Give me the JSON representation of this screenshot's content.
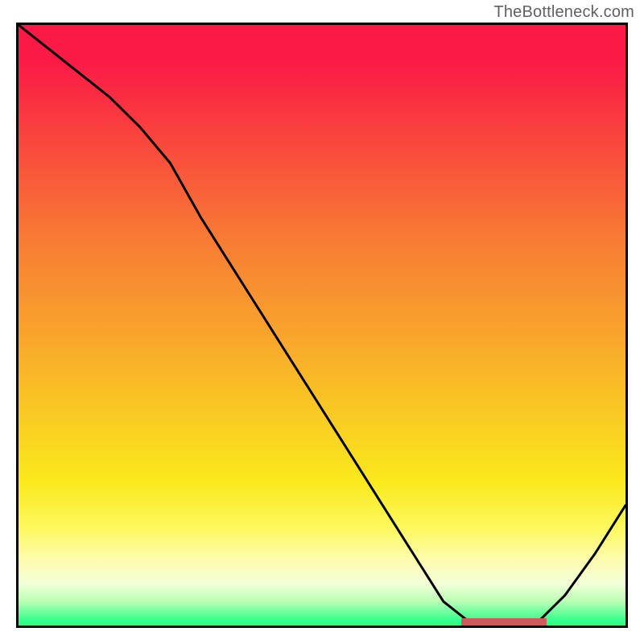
{
  "watermark": "TheBottleneck.com",
  "colors": {
    "gradient_top": "#fb1a46",
    "gradient_mid1": "#f87c34",
    "gradient_mid2": "#fae91c",
    "gradient_bottom": "#26ff7e",
    "line": "#000000",
    "marker": "#cc5b5b",
    "border": "#000000"
  },
  "chart_data": {
    "type": "line",
    "title": "",
    "xlabel": "",
    "ylabel": "",
    "xlim": [
      0,
      100
    ],
    "ylim": [
      0,
      100
    ],
    "x": [
      0,
      5,
      10,
      15,
      20,
      25,
      30,
      35,
      40,
      45,
      50,
      55,
      60,
      65,
      70,
      75,
      80,
      85,
      90,
      95,
      100
    ],
    "values": [
      100,
      96,
      92,
      88,
      83,
      77,
      68,
      60,
      52,
      44,
      36,
      28,
      20,
      12,
      4,
      0,
      0,
      0,
      5,
      12,
      20
    ],
    "marker_range_x": [
      73,
      87
    ],
    "marker_y": 0.6,
    "grid": false,
    "legend": false
  }
}
